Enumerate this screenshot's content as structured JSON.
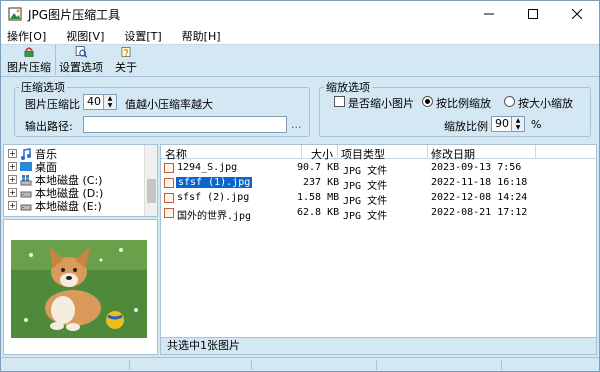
{
  "window": {
    "title": "JPG图片压缩工具"
  },
  "menu": [
    "操作[O]",
    "视图[V]",
    "设置[T]",
    "帮助[H]"
  ],
  "toolbar": {
    "compress": "图片压缩",
    "settings": "设置选项",
    "about": "关于"
  },
  "compress_options": {
    "legend": "压缩选项",
    "ratio_label": "图片压缩比",
    "ratio_value": "40",
    "ratio_hint": "值越小压缩率越大",
    "output_label": "输出路径:",
    "output_value": "",
    "browse": "..."
  },
  "scale_options": {
    "legend": "缩放选项",
    "shrink_label": "是否缩小图片",
    "proportional_label": "按比例缩放",
    "by_size_label": "按大小缩放",
    "scale_label": "缩放比例",
    "scale_value": "90",
    "scale_unit": "%"
  },
  "tree": [
    "音乐",
    "桌面",
    "本地磁盘 (C:)",
    "本地磁盘 (D:)",
    "本地磁盘 (E:)"
  ],
  "list": {
    "headers": {
      "name": "名称",
      "size": "大小",
      "type": "项目类型",
      "modified": "修改日期"
    },
    "rows": [
      {
        "name": "1294_S.jpg",
        "size": "90.7 KB",
        "type": "JPG 文件",
        "modified": "2023-09-13 7:56"
      },
      {
        "name": "sfsf (1).jpg",
        "size": "237 KB",
        "type": "JPG 文件",
        "modified": "2022-11-18 16:18"
      },
      {
        "name": "sfsf (2).jpg",
        "size": "1.58 MB",
        "type": "JPG 文件",
        "modified": "2022-12-08 14:24"
      },
      {
        "name": "国外的世界.jpg",
        "size": "62.8 KB",
        "type": "JPG 文件",
        "modified": "2022-08-21 17:12"
      }
    ],
    "status": "共选中1张图片"
  },
  "colors": {
    "panel": "#d4e8f4",
    "selection": "#0a66c8",
    "border": "#a9c1d4"
  }
}
